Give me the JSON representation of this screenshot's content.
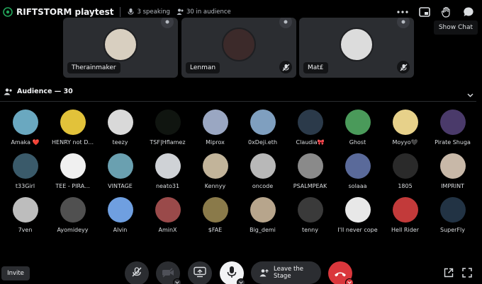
{
  "header": {
    "title": "RIFTSTORM playtest",
    "speaking": "3 speaking",
    "audience_count": "30 in audience"
  },
  "tooltip": "Show Chat",
  "speakers": [
    {
      "name": "Therainmaker",
      "color": "#d8cfc0"
    },
    {
      "name": "Lenman",
      "color": "#3c2a2a"
    },
    {
      "name": "Mat£",
      "color": "#dcdcdc"
    }
  ],
  "audience": {
    "title": "Audience — 30",
    "members": [
      {
        "name": "Amaka ❤️",
        "color": "#6aa8c0"
      },
      {
        "name": "HENRY not D...",
        "color": "#e2c23a"
      },
      {
        "name": "teezy",
        "color": "#d9d9d9"
      },
      {
        "name": "TSF|Hflamez",
        "color": "#101510"
      },
      {
        "name": "Miprox",
        "color": "#9aa7c2"
      },
      {
        "name": "0xDeji.eth",
        "color": "#7f9fbf"
      },
      {
        "name": "Claudia🎀",
        "color": "#2b3a4a"
      },
      {
        "name": "Ghost",
        "color": "#4a9a5a"
      },
      {
        "name": "Moyyo🖤",
        "color": "#e7d18a"
      },
      {
        "name": "Pirate Shuga",
        "color": "#4a3a6a"
      },
      {
        "name": "t33Girl",
        "color": "#3a5a6a"
      },
      {
        "name": "TEE - PIRA...",
        "color": "#f0f0f0"
      },
      {
        "name": "VINTAGE",
        "color": "#6aa0b0"
      },
      {
        "name": "neato31",
        "color": "#cfd2d6"
      },
      {
        "name": "Kennyy",
        "color": "#c2b49a"
      },
      {
        "name": "oncode",
        "color": "#b8b8b8"
      },
      {
        "name": "PSALMPEAK",
        "color": "#8a8a8a"
      },
      {
        "name": "solaaa",
        "color": "#5a6a9a"
      },
      {
        "name": "1805",
        "color": "#2a2a2a"
      },
      {
        "name": "IMPRINT",
        "color": "#c8b8a8"
      },
      {
        "name": "7ven",
        "color": "#bdbdbd"
      },
      {
        "name": "Ayomideyy",
        "color": "#505050"
      },
      {
        "name": "Alvin",
        "color": "#6f9fe0"
      },
      {
        "name": "AminX",
        "color": "#9a4a4a"
      },
      {
        "name": "$FAE",
        "color": "#8a7a4a"
      },
      {
        "name": "Big_demi",
        "color": "#b7a58c"
      },
      {
        "name": "tenny",
        "color": "#3a3a3a"
      },
      {
        "name": "I'll never cope",
        "color": "#e8e8e8"
      },
      {
        "name": "Hell Rider",
        "color": "#c23a3a"
      },
      {
        "name": "SuperFly",
        "color": "#223344"
      }
    ]
  },
  "bottom": {
    "invite_label": "Invite",
    "leave_label": "Leave the Stage"
  },
  "icons": {
    "header": [
      "stage-icon",
      "mic-icon",
      "audience-icon"
    ],
    "header_right": [
      "more-icon",
      "popout-icon",
      "raise-hand-icon",
      "chat-icon"
    ],
    "controls": [
      "mute-icon",
      "camera-off-icon",
      "screen-share-icon",
      "microphone-icon",
      "disconnect-icon"
    ],
    "bottom_right": [
      "open-external-icon",
      "fullscreen-icon"
    ]
  }
}
